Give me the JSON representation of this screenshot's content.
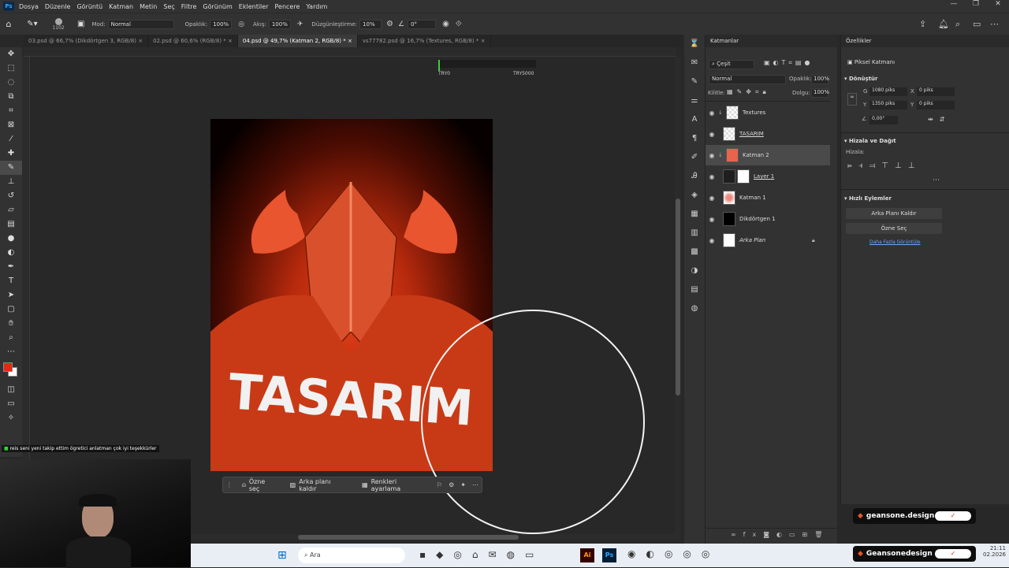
{
  "menubar": {
    "items": [
      "Dosya",
      "Düzenle",
      "Görüntü",
      "Katman",
      "Metin",
      "Seç",
      "Filtre",
      "Görünüm",
      "Eklentiler",
      "Pencere",
      "Yardım"
    ]
  },
  "options": {
    "brush_size": "1102",
    "mode_label": "Mod:",
    "mode_value": "Normal",
    "opacity_label": "Opaklık:",
    "opacity_value": "100%",
    "flow_label": "Akış:",
    "flow_value": "100%",
    "smoothing_label": "Düzgünleştirme:",
    "smoothing_value": "10%",
    "angle_value": "0°"
  },
  "tabs": [
    {
      "label": "03.psd @ 66,7% (Dikdörtgen 3, RGB/8)"
    },
    {
      "label": "02.psd @ 60,6% (RGB/8) *"
    },
    {
      "label": "04.psd @ 49,7% (Katman 2, RGB/8) *"
    },
    {
      "label": "vs77782.psd @ 16,7% (Textures, RGB/8) *"
    }
  ],
  "guide": {
    "left": "TRY0",
    "right": "TRY5000"
  },
  "canvas": {
    "title_text": "TASARIM"
  },
  "context_bar": {
    "select_subject": "Özne seç",
    "remove_bg": "Arka planı kaldır",
    "adjust_colors": "Renkleri ayarlama"
  },
  "layers_panel": {
    "title": "Katmanlar",
    "filter_label": "Çeşit",
    "blend_mode": "Normal",
    "opacity_label": "Opaklık:",
    "opacity_value": "100%",
    "lock_label": "Kilitle:",
    "fill_label": "Dolgu:",
    "fill_value": "100%",
    "layers": [
      {
        "name": "Textures"
      },
      {
        "name": "TASARIM"
      },
      {
        "name": "Katman 2"
      },
      {
        "name": "Layer 1"
      },
      {
        "name": "Katman 1"
      },
      {
        "name": "Dikdörtgen 1"
      },
      {
        "name": "Arka Plan"
      }
    ]
  },
  "properties": {
    "title": "Özellikler",
    "pixel_layer": "Piksel Katmanı",
    "transform_title": "Dönüştür",
    "w_label": "G",
    "w_value": "1080 piks",
    "h_label": "Y",
    "h_value": "1350 piks",
    "x_label": "X",
    "x_value": "0 piks",
    "y_label": "Y",
    "y_value": "0 piks",
    "angle_value": "0,00°",
    "align_title": "Hizala ve Dağıt",
    "align_label": "Hizala:",
    "quick_title": "Hızlı Eylemler",
    "remove_bg": "Arka Planı Kaldır",
    "select_subject": "Özne Seç",
    "more_link": "Daha Fazla Görüntüle"
  },
  "chat": {
    "text": "reis seni yeni takip ettim ögretici anlatman çok iyi teşekkürler"
  },
  "taskbar": {
    "search": "Ara",
    "time": "21:11",
    "date": "02.2026"
  },
  "badges": {
    "top": "geansone.design",
    "bottom": "Geansonedesign"
  }
}
